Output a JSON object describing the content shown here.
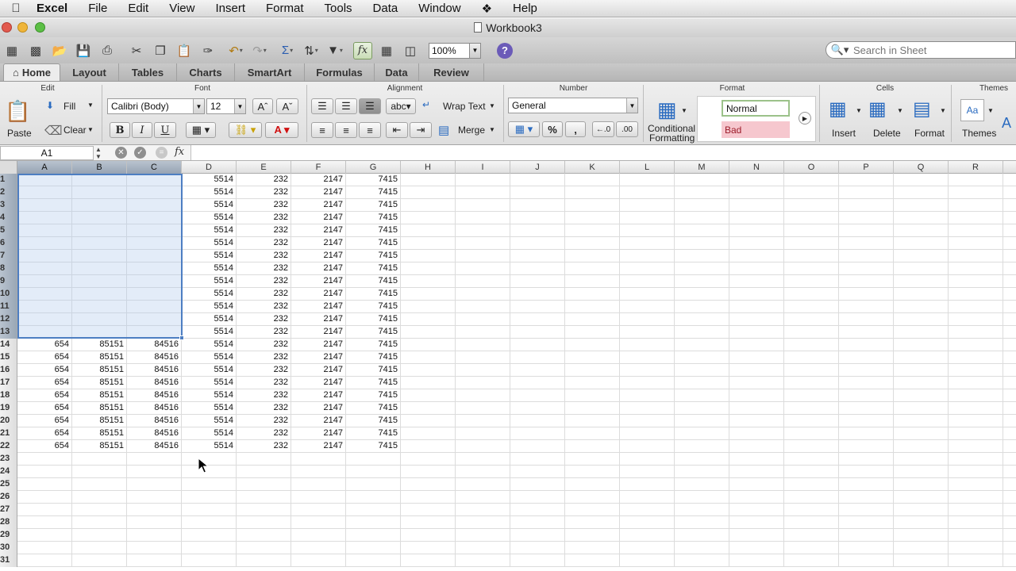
{
  "menubar": {
    "app": "Excel",
    "items": [
      "File",
      "Edit",
      "View",
      "Insert",
      "Format",
      "Tools",
      "Data",
      "Window",
      "Help"
    ]
  },
  "window": {
    "title": "Workbook3"
  },
  "toolbar": {
    "zoom": "100%",
    "search_placeholder": "Search in Sheet"
  },
  "ribbon_tabs": [
    "Home",
    "Layout",
    "Tables",
    "Charts",
    "SmartArt",
    "Formulas",
    "Data",
    "Review"
  ],
  "ribbon": {
    "groups": {
      "edit": "Edit",
      "font": "Font",
      "alignment": "Alignment",
      "number": "Number",
      "format": "Format",
      "cells": "Cells",
      "themes": "Themes"
    },
    "paste": "Paste",
    "fill": "Fill",
    "clear": "Clear",
    "font_name": "Calibri (Body)",
    "font_size": "12",
    "bold": "B",
    "italic": "I",
    "underline": "U",
    "wrap_text": "Wrap Text",
    "merge": "Merge",
    "number_format": "General",
    "conditional_formatting_line1": "Conditional",
    "conditional_formatting_line2": "Formatting",
    "style_normal": "Normal",
    "style_bad": "Bad",
    "insert": "Insert",
    "delete": "Delete",
    "format": "Format",
    "themes": "Themes",
    "percent": "%",
    "comma": ","
  },
  "formula_bar": {
    "name_box": "A1",
    "fx": "fx",
    "formula": ""
  },
  "sheet": {
    "columns": [
      "A",
      "B",
      "C",
      "D",
      "E",
      "F",
      "G",
      "H",
      "I",
      "J",
      "K",
      "L",
      "M",
      "N",
      "O",
      "P",
      "Q",
      "R"
    ],
    "selected_columns": [
      "A",
      "B",
      "C"
    ],
    "selected_rows": 13,
    "row_count": 31,
    "rows": [
      [
        "",
        "",
        "",
        "5514",
        "232",
        "2147",
        "7415"
      ],
      [
        "",
        "",
        "",
        "5514",
        "232",
        "2147",
        "7415"
      ],
      [
        "",
        "",
        "",
        "5514",
        "232",
        "2147",
        "7415"
      ],
      [
        "",
        "",
        "",
        "5514",
        "232",
        "2147",
        "7415"
      ],
      [
        "",
        "",
        "",
        "5514",
        "232",
        "2147",
        "7415"
      ],
      [
        "",
        "",
        "",
        "5514",
        "232",
        "2147",
        "7415"
      ],
      [
        "",
        "",
        "",
        "5514",
        "232",
        "2147",
        "7415"
      ],
      [
        "",
        "",
        "",
        "5514",
        "232",
        "2147",
        "7415"
      ],
      [
        "",
        "",
        "",
        "5514",
        "232",
        "2147",
        "7415"
      ],
      [
        "",
        "",
        "",
        "5514",
        "232",
        "2147",
        "7415"
      ],
      [
        "",
        "",
        "",
        "5514",
        "232",
        "2147",
        "7415"
      ],
      [
        "",
        "",
        "",
        "5514",
        "232",
        "2147",
        "7415"
      ],
      [
        "",
        "",
        "",
        "5514",
        "232",
        "2147",
        "7415"
      ],
      [
        "654",
        "85151",
        "84516",
        "5514",
        "232",
        "2147",
        "7415"
      ],
      [
        "654",
        "85151",
        "84516",
        "5514",
        "232",
        "2147",
        "7415"
      ],
      [
        "654",
        "85151",
        "84516",
        "5514",
        "232",
        "2147",
        "7415"
      ],
      [
        "654",
        "85151",
        "84516",
        "5514",
        "232",
        "2147",
        "7415"
      ],
      [
        "654",
        "85151",
        "84516",
        "5514",
        "232",
        "2147",
        "7415"
      ],
      [
        "654",
        "85151",
        "84516",
        "5514",
        "232",
        "2147",
        "7415"
      ],
      [
        "654",
        "85151",
        "84516",
        "5514",
        "232",
        "2147",
        "7415"
      ],
      [
        "654",
        "85151",
        "84516",
        "5514",
        "232",
        "2147",
        "7415"
      ],
      [
        "654",
        "85151",
        "84516",
        "5514",
        "232",
        "2147",
        "7415"
      ]
    ]
  }
}
